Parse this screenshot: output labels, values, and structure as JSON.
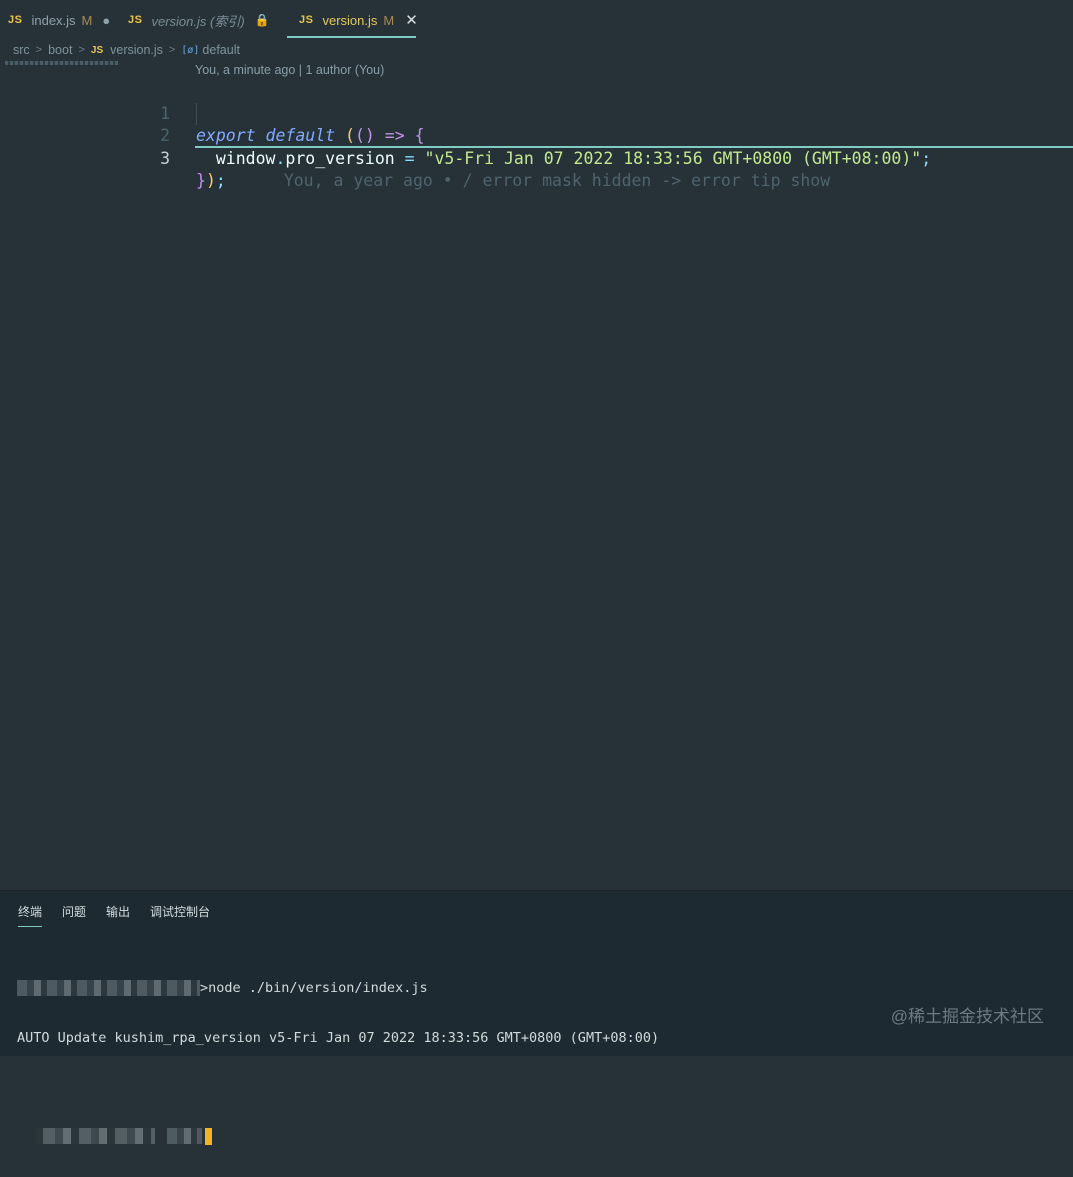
{
  "tabs": [
    {
      "icon": "JS",
      "label": "index.js",
      "status": "M",
      "indicator": "●",
      "active": false
    },
    {
      "icon": "JS",
      "label": "version.js (索引)",
      "status": "",
      "indicator": "🔒",
      "active": false
    },
    {
      "icon": "JS",
      "label": "version.js",
      "status": "M",
      "indicator": "✕",
      "active": true
    }
  ],
  "breadcrumb": {
    "items": [
      "src",
      "boot",
      "version.js",
      "default"
    ],
    "file_icon": "JS",
    "symbol_icon": "[ø]"
  },
  "editor": {
    "codelens": "You, a minute ago | 1 author (You)",
    "lines": [
      {
        "number": "1",
        "text": "export default (() => {"
      },
      {
        "number": "2",
        "text": "  window.pro_version = \"v5-Fri Jan 07 2022 18:33:56 GMT+0800 (GMT+08:00)\";"
      },
      {
        "number": "3",
        "text": "});"
      }
    ],
    "current_line": 3,
    "inline_blame": "You, a year ago • / error mask hidden -> error tip show",
    "tokens": {
      "kw_export": "export",
      "kw_default": "default",
      "paren_open": "(",
      "paren_args": "()",
      "arrow": "=>",
      "brace_open": "{",
      "obj": "window",
      "dot": ".",
      "prop": "pro_version",
      "assign": "=",
      "string": "\"v5-Fri Jan 07 2022 18:33:56 GMT+0800 (GMT+08:00)\"",
      "semi": ";",
      "brace_close": "}",
      "paren_close": ")",
      "end_semi": ";"
    }
  },
  "panel": {
    "tabs": [
      "终端",
      "问题",
      "输出",
      "调试控制台"
    ],
    "active_tab": "终端",
    "terminal": {
      "command": ">node ./bin/version/index.js",
      "output": "AUTO Update kushim_rpa_version v5-Fri Jan 07 2022 18:33:56 GMT+0800 (GMT+08:00)"
    }
  },
  "watermark": "@稀土掘金技术社区",
  "colors": {
    "background": "#263238",
    "panel_background": "#1e2a31",
    "accent": "#80cbc4",
    "js_icon": "#e8c547",
    "modified": "#a38d55"
  }
}
